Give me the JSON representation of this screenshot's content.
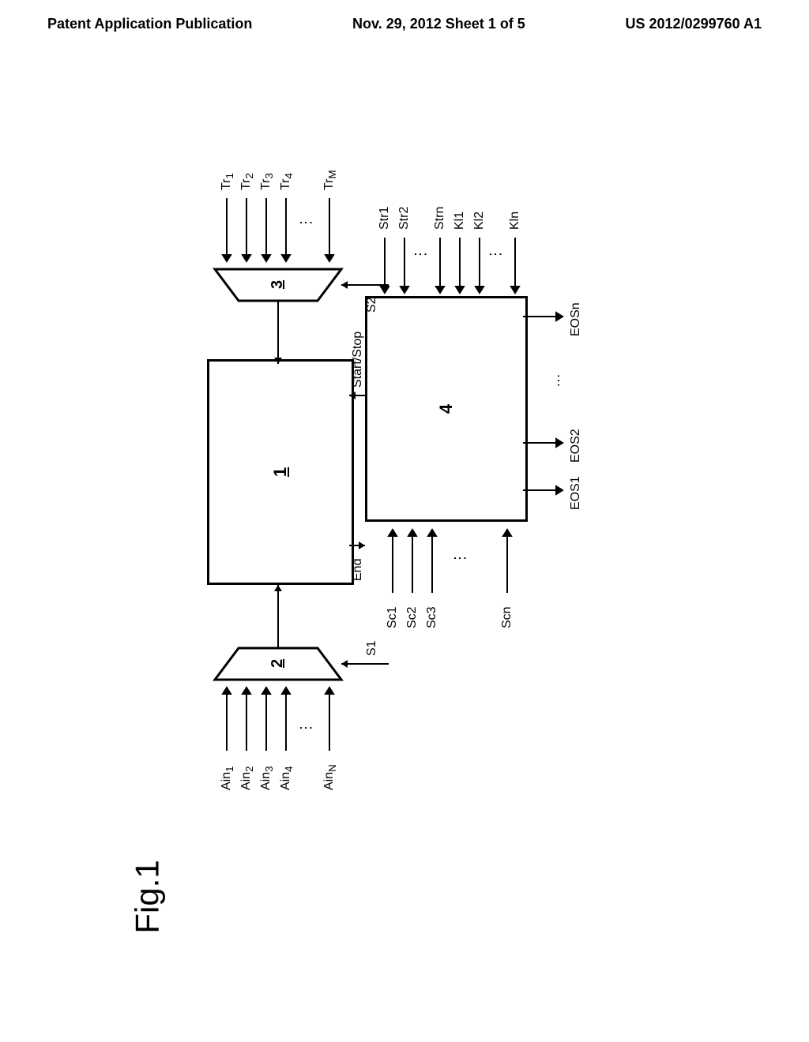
{
  "header": {
    "left": "Patent Application Publication",
    "center": "Nov. 29, 2012  Sheet 1 of 5",
    "right": "US 2012/0299760 A1"
  },
  "figure_label": "Fig.1",
  "blocks": {
    "b1_label": "1",
    "b2_label": "2",
    "b3_label": "3",
    "b4_label": "4"
  },
  "signals": {
    "ain1": "Ain",
    "ain1_sub": "1",
    "ain2": "Ain",
    "ain2_sub": "2",
    "ain3": "Ain",
    "ain3_sub": "3",
    "ain4": "Ain",
    "ain4_sub": "4",
    "ainn": "Ain",
    "ainn_sub": "N",
    "tr1": "Tr",
    "tr1_sub": "1",
    "tr2": "Tr",
    "tr2_sub": "2",
    "tr3": "Tr",
    "tr3_sub": "3",
    "tr4": "Tr",
    "tr4_sub": "4",
    "trm": "Tr",
    "trm_sub": "M",
    "s1": "S1",
    "s2": "S2",
    "start_stop": "Start/Stop",
    "end": "End",
    "str1": "Str1",
    "str2": "Str2",
    "strn": "Strn",
    "kl1": "Kl1",
    "kl2": "Kl2",
    "kln": "Kln",
    "sc1": "Sc1",
    "sc2": "Sc2",
    "sc3": "Sc3",
    "scn": "Scn",
    "eos1": "EOS1",
    "eos2": "EOS2",
    "eosn": "EOSn"
  }
}
